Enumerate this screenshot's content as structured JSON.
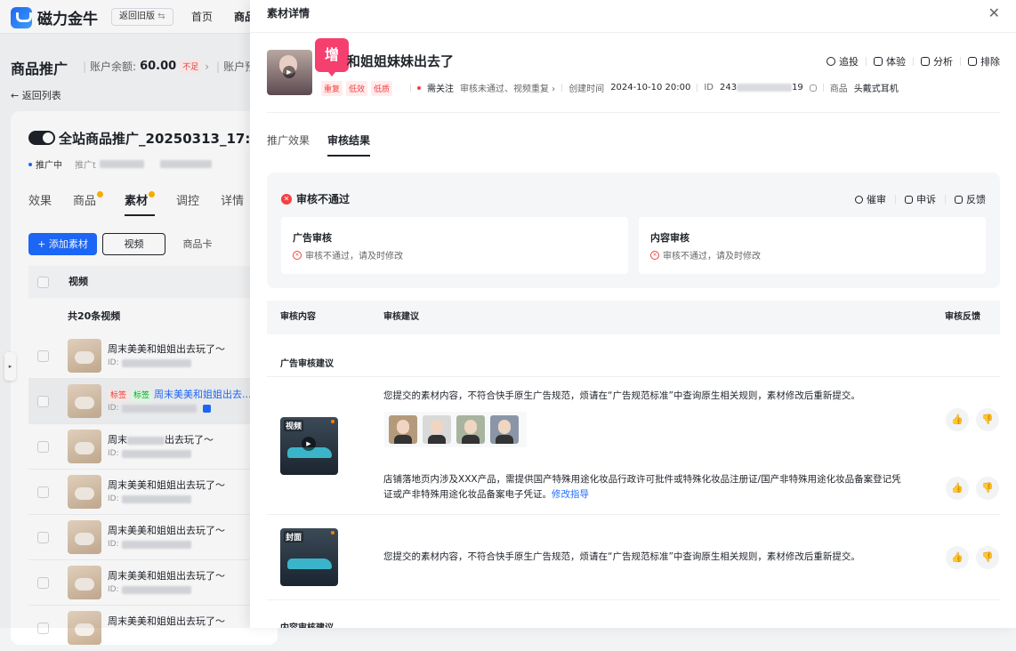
{
  "app": {
    "logo_text": "磁力金牛",
    "old_version": "返回旧版",
    "old_version_suffix": "⇆",
    "nav_home": "首页",
    "nav_product": "商品"
  },
  "left": {
    "page_title": "商品推广",
    "balance_label": "账户余额:",
    "balance_value": "60.00",
    "balance_tag": "不足",
    "balance_more": "账户预",
    "back": "← 返回列表",
    "plan_name": "全站商品推广_20250313_17:4",
    "status": "推广中",
    "status_extra": "推广t",
    "tabs": [
      "效果",
      "商品",
      "素材",
      "调控",
      "详情"
    ],
    "add_material": "+ 添加素材",
    "btn_video": "视频",
    "btn_card": "商品卡",
    "table_header": "视频",
    "count": "共20条视频",
    "rows": [
      {
        "title": "周末美美和姐姐出去玩了～",
        "id": "ID:"
      },
      {
        "tag1": "标签",
        "tag2": "标签",
        "title": "周末美美和姐姐出去...",
        "id": "ID:"
      },
      {
        "title": "周末",
        "title_end": "出去玩了～",
        "id": "ID:"
      },
      {
        "title": "周末美美和姐姐出去玩了～",
        "id": "ID:"
      },
      {
        "title": "周末美美和姐姐出去玩了～",
        "id": "ID:"
      },
      {
        "title": "周末美美和姐姐出去玩了～",
        "id": "ID:"
      },
      {
        "title": "周末美美和姐姐出去玩了～",
        "id": "ID:"
      }
    ],
    "handle": "▸"
  },
  "drawer": {
    "title": "素材详情",
    "close": "✕",
    "zeng": "增",
    "material_title": "和姐姐妹妹出去了",
    "tags": [
      "重复",
      "低效",
      "低质"
    ],
    "attention": "需关注",
    "attention_detail": "审核未通过、视频重复 ›",
    "created_label": "创建时间",
    "created_value": "2024-10-10 20:00",
    "id_label": "ID",
    "id_prefix": "243",
    "id_suffix": "19",
    "product_label": "商品",
    "product_value": "头戴式耳机",
    "actions": [
      "追投",
      "体验",
      "分析",
      "排除"
    ],
    "tabs": [
      "推广效果",
      "审核结果"
    ],
    "review": {
      "title": "审核不通过",
      "actions": [
        "催审",
        "申诉",
        "反馈"
      ],
      "ad_title": "广告审核",
      "ad_msg": "审核不通过，请及时修改",
      "content_title": "内容审核",
      "content_msg": "审核不通过，请及时修改"
    },
    "table": {
      "col_content": "审核内容",
      "col_suggestion": "审核建议",
      "col_feedback": "审核反馈",
      "ad_section": "广告审核建议",
      "media_video": "视频",
      "media_cover": "封面",
      "suggestion1": "您提交的素材内容，不符合快手原生广告规范，烦请在“广告规范标准”中查询原生相关规则，素材修改后重新提交。",
      "suggestion2": "店铺落地页内涉及XXX产品，需提供国产特殊用途化妆品行政许可批件或特殊化妆品注册证/国产非特殊用途化妆品备案登记凭证或产非特殊用途化妆品备案电子凭证。",
      "suggestion2_link": "修改指导",
      "suggestion3": "您提交的素材内容，不符合快手原生广告规范，烦请在“广告规范标准”中查询原生相关规则，素材修改后重新提交。",
      "content_section": "内容审核建议"
    }
  }
}
